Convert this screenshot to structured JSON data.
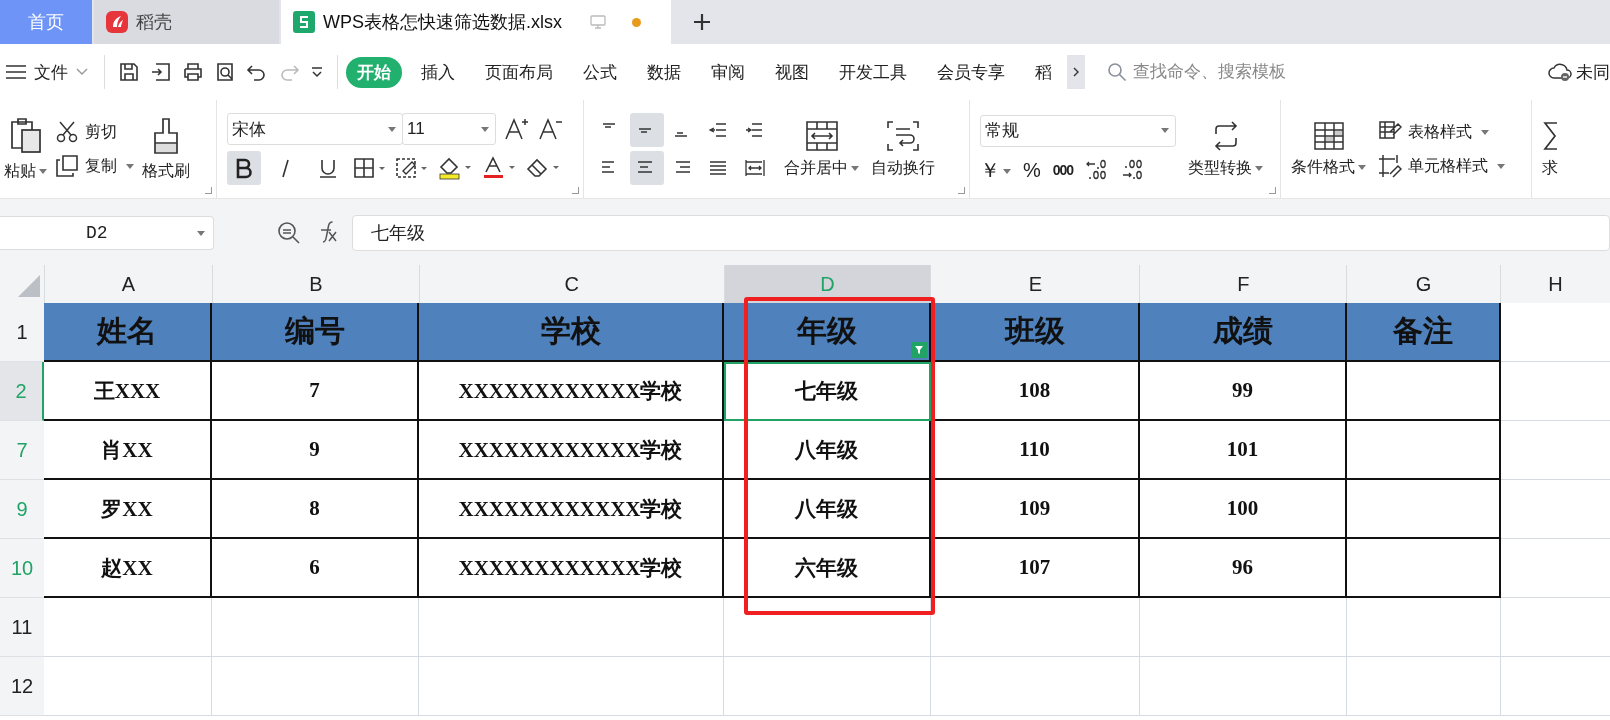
{
  "tabs": [
    {
      "label": "首页",
      "kind": "home",
      "selected": false
    },
    {
      "label": "稻壳",
      "kind": "app",
      "selected": false
    },
    {
      "label": "WPS表格怎快速筛选数据.xlsx",
      "kind": "document",
      "selected": true
    }
  ],
  "menu": {
    "file": "文件",
    "items": [
      {
        "label": "开始",
        "selected": true
      },
      {
        "label": "插入",
        "selected": false
      },
      {
        "label": "页面布局",
        "selected": false
      },
      {
        "label": "公式",
        "selected": false
      },
      {
        "label": "数据",
        "selected": false
      },
      {
        "label": "审阅",
        "selected": false
      },
      {
        "label": "视图",
        "selected": false
      },
      {
        "label": "开发工具",
        "selected": false
      },
      {
        "label": "会员专享",
        "selected": false
      },
      {
        "label": "稻",
        "selected": false
      }
    ],
    "search": {
      "placeholder": "查找命令、搜索模板"
    },
    "sync": "未同"
  },
  "ribbon": {
    "paste": "粘贴",
    "cut": "剪切",
    "copy": "复制",
    "format_painter": "格式刷",
    "font_name": "宋体",
    "font_size": "11",
    "font_buttons": [
      {
        "kind": "bold",
        "selected": true
      },
      {
        "kind": "italic",
        "selected": false
      },
      {
        "kind": "underline",
        "selected": false
      }
    ],
    "align_top": [
      {
        "kind": "top",
        "selected": false
      },
      {
        "kind": "middle",
        "selected": true
      },
      {
        "kind": "bottom",
        "selected": false
      },
      {
        "kind": "outdent",
        "selected": false
      },
      {
        "kind": "indent",
        "selected": false
      }
    ],
    "align_bottom": [
      {
        "kind": "left",
        "selected": false
      },
      {
        "kind": "center",
        "selected": true
      },
      {
        "kind": "right",
        "selected": false
      },
      {
        "kind": "justify",
        "selected": false
      },
      {
        "kind": "distributed",
        "selected": false
      }
    ],
    "merge": "合并居中",
    "wrap": "自动换行",
    "number_format": "常规",
    "currency": "￥",
    "percent": "%",
    "thousands": "000",
    "convert": "类型转换",
    "conditional": "条件格式",
    "table_style": "表格样式",
    "cell_style": "单元格样式",
    "sum": "求"
  },
  "formula_bar": {
    "name_box": "D2",
    "value": "七年级"
  },
  "sheet": {
    "columns": [
      {
        "label": "A",
        "selected": false,
        "highlighted": false
      },
      {
        "label": "B",
        "selected": false,
        "highlighted": false
      },
      {
        "label": "C",
        "selected": false,
        "highlighted": false
      },
      {
        "label": "D",
        "selected": true,
        "highlighted": true
      },
      {
        "label": "E",
        "selected": false,
        "highlighted": false
      },
      {
        "label": "F",
        "selected": false,
        "highlighted": false
      },
      {
        "label": "G",
        "selected": false,
        "highlighted": false
      },
      {
        "label": "H",
        "selected": false,
        "highlighted": false
      }
    ],
    "header": [
      {
        "text": "姓名",
        "filter": false
      },
      {
        "text": "编号",
        "filter": false
      },
      {
        "text": "学校",
        "filter": false
      },
      {
        "text": "年级",
        "filter": true
      },
      {
        "text": "班级",
        "filter": false
      },
      {
        "text": "成绩",
        "filter": false
      },
      {
        "text": "备注",
        "filter": false
      }
    ],
    "rows": [
      {
        "number": "1",
        "filtered": false,
        "selected": false,
        "kind": "header",
        "cells": []
      },
      {
        "number": "2",
        "filtered": true,
        "selected": true,
        "kind": "data",
        "cells": [
          "王XXX",
          "7",
          "XXXXXXXXXXXX学校",
          "七年级",
          "108",
          "99",
          ""
        ]
      },
      {
        "number": "7",
        "filtered": true,
        "selected": false,
        "kind": "data",
        "cells": [
          "肖XX",
          "9",
          "XXXXXXXXXXXX学校",
          "八年级",
          "110",
          "101",
          ""
        ]
      },
      {
        "number": "9",
        "filtered": true,
        "selected": false,
        "kind": "data",
        "cells": [
          "罗XX",
          "8",
          "XXXXXXXXXXXX学校",
          "八年级",
          "109",
          "100",
          ""
        ]
      },
      {
        "number": "10",
        "filtered": true,
        "selected": false,
        "kind": "data",
        "cells": [
          "赵XX",
          "6",
          "XXXXXXXXXXXX学校",
          "六年级",
          "107",
          "96",
          ""
        ]
      },
      {
        "number": "11",
        "filtered": false,
        "selected": false,
        "kind": "empty",
        "cells": []
      },
      {
        "number": "12",
        "filtered": false,
        "selected": false,
        "kind": "empty",
        "cells": []
      }
    ]
  }
}
